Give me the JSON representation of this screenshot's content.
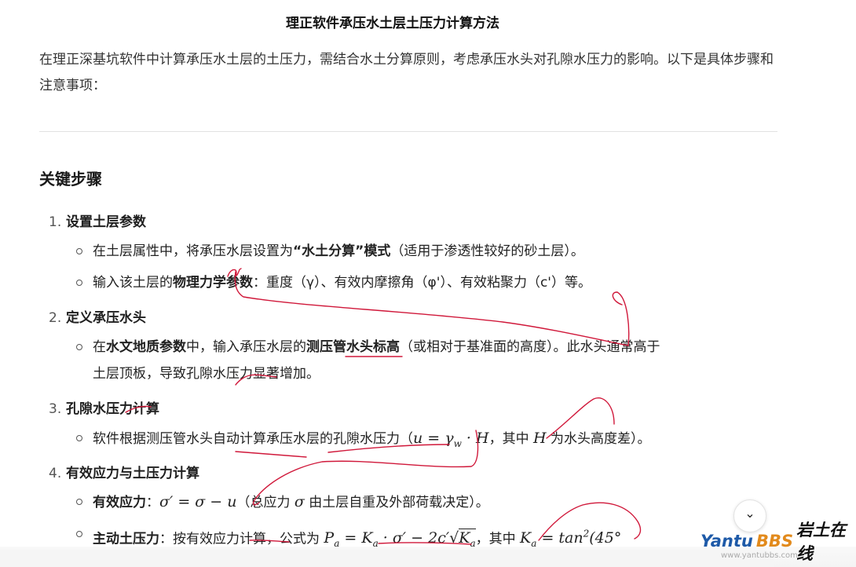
{
  "document": {
    "title": "理正软件承压水土层土压力计算方法",
    "intro": "在理正深基坑软件中计算承压水土层的土压力，需结合水土分算原则，考虑承压水头对孔隙水压力的影响。以下是具体步骤和注意事项：",
    "section_heading": "关键步骤"
  },
  "steps": [
    {
      "number": "1.",
      "title": "设置土层参数",
      "bullets": [
        {
          "t1": "在土层属性中，将承压水层设置为",
          "b1": "“水土分算”模式",
          "t2": "（适用于渗透性较好的砂土层）。"
        },
        {
          "t1": "输入该土层的",
          "b1": "物理力学参数",
          "t2": "：重度（γ）、有效内摩擦角（φ'）、有效粘聚力（c'）等。"
        }
      ]
    },
    {
      "number": "2.",
      "title": "定义承压水头",
      "bullets": [
        {
          "t1": "在",
          "b1": "水文地质参数",
          "t2": "中，输入承压水层的",
          "b2": "测压管水头标高",
          "t3": "（或相对于基准面的高度）。此水头通常高于",
          "line2": "土层顶板，导致孔隙水压力显著增加。"
        }
      ]
    },
    {
      "number": "3.",
      "title": "孔隙水压力计算",
      "bullets": [
        {
          "t1": "软件根据测压管水头自动计算承压水层的孔隙水压力（",
          "m1": "u = γ",
          "m1sub": "w",
          "m1b": " · H",
          "t2": "，其中 ",
          "m2": "H",
          "t3": " 为水头高度差）。"
        }
      ]
    },
    {
      "number": "4.",
      "title": "有效应力与土压力计算",
      "bullets": [
        {
          "b1": "有效应力",
          "t1": "：",
          "m1": "σ′ = σ − u",
          "t2": "（总应力 ",
          "m2": "σ",
          "t3": " 由土层自重及外部荷载决定）。"
        },
        {
          "b1": "主动土压力",
          "t1": "：按有效应力计算，公式为 ",
          "m1": "P",
          "m1sub": "a",
          "m1b": " = K",
          "m1sub2": "a",
          "m1c": " · σ′ − 2c′",
          "m1sqrt": "K",
          "m1sqrtsub": "a",
          "t2": "，其中 ",
          "m2": "K",
          "m2sub": "a",
          "m2b": " = tan",
          "m2sup": "2",
          "m2c": "(45°"
        }
      ]
    }
  ],
  "ui": {
    "scroll_down_icon": "chevron-down-icon",
    "scroll_down_glyph": "⌄"
  },
  "watermark": {
    "part1": "Yantu",
    "part2": "BBS",
    "part3": "岩土在线",
    "url": "www.yantubbs.com"
  },
  "colors": {
    "scribble": "#d0183a",
    "watermark_blue": "#1e5aa8",
    "watermark_orange": "#e28a1c"
  }
}
